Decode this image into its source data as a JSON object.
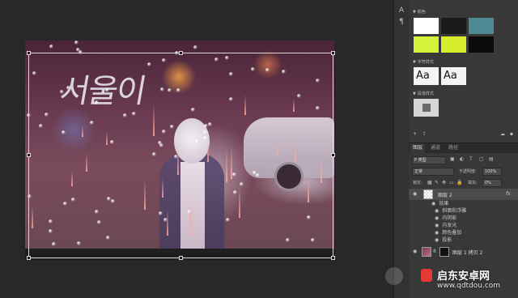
{
  "tool_strip": {
    "icons": [
      "text-tool-icon",
      "paragraph-icon"
    ],
    "text_tool": "A",
    "paragraph": "¶"
  },
  "panels": {
    "swatches_title": "颜色",
    "swatches": [
      "#ffffff",
      "#1a1a1a",
      "#4d8a94",
      "#d4f23a",
      "#d7ee2f",
      "#0a0a0a"
    ],
    "char_styles_title": "字符样式",
    "char_style_labels": [
      "Aa",
      "Aa"
    ],
    "para_styles_title": "段落样式"
  },
  "layers_panel": {
    "tabs": [
      "图层",
      "通道",
      "路径"
    ],
    "filter_label": "P 类型",
    "blend_mode": "正常",
    "opacity_label": "不透明度:",
    "opacity_value": "100%",
    "lock_label": "锁定:",
    "fill_label": "填充:",
    "fill_value": "0%",
    "layers": [
      {
        "name": "图层 2",
        "fx": "fx",
        "selected": true
      },
      {
        "name": "图层 1 拷贝 2",
        "selected": false
      }
    ],
    "effects_header": "效果",
    "effects": [
      "斜面和浮雕",
      "内阴影",
      "内发光",
      "颜色叠加",
      "投影"
    ]
  },
  "canvas": {
    "neon_text": "서울이"
  },
  "watermark": {
    "title": "启东安卓网",
    "url": "www.qdtdou.com"
  }
}
